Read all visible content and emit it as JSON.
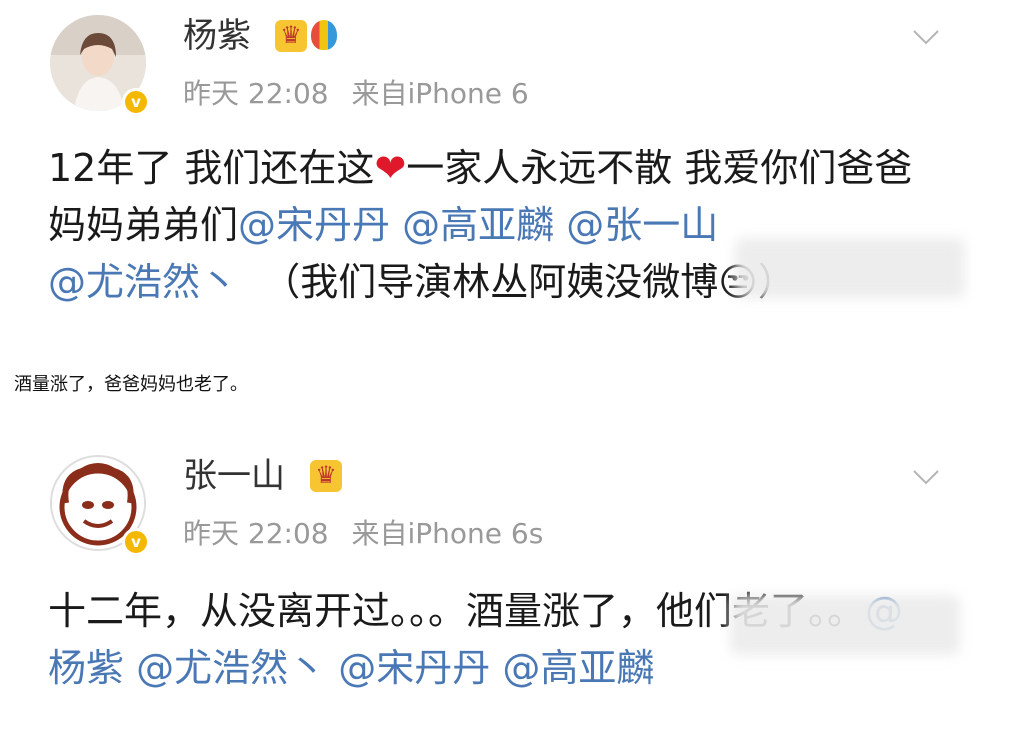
{
  "post1": {
    "username": "杨紫",
    "time": "昨天 22:08",
    "source": "来自iPhone 6",
    "text_a": "12年了 我们还在这",
    "heart": "❤",
    "text_b": "一家人永远不散 我爱你们爸爸妈妈弟弟们",
    "mentions": [
      "@宋丹丹",
      "@高亚麟",
      "@张一山",
      "@尤浩然丶"
    ],
    "text_c": "（我们导演林丛阿姨没微博",
    "text_d": "）",
    "badges": [
      "crown-badge-icon",
      "balloon-badge-icon"
    ]
  },
  "caption": "酒量涨了，爸爸妈妈也老了。",
  "post2": {
    "username": "张一山",
    "time": "昨天 22:08",
    "source": "来自iPhone 6s",
    "text_a": "十二年，从没离开过。。。酒量涨了，他们老了。。",
    "mentions": [
      "@杨紫",
      "@尤浩然丶",
      "@宋丹丹",
      "@高亚麟"
    ],
    "badges": [
      "crown-badge-icon"
    ]
  },
  "colors": {
    "mention": "#4a78b5",
    "meta": "#999999",
    "verified": "#f5b800"
  }
}
